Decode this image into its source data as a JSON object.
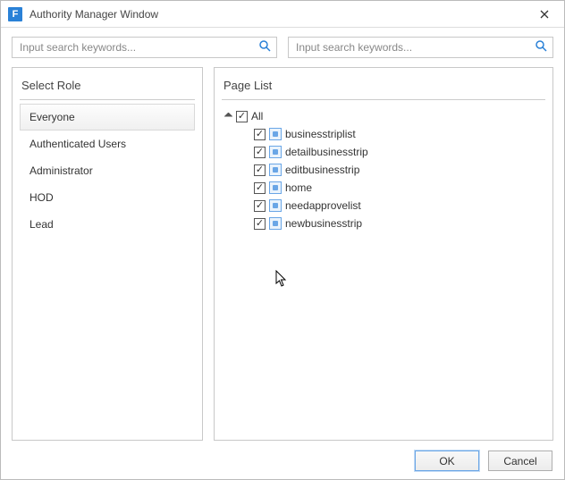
{
  "window": {
    "app_icon_letter": "F",
    "title": "Authority Manager Window"
  },
  "search": {
    "left_placeholder": "Input search keywords...",
    "right_placeholder": "Input search keywords..."
  },
  "roles": {
    "title": "Select Role",
    "items": [
      {
        "label": "Everyone",
        "selected": true
      },
      {
        "label": "Authenticated Users",
        "selected": false
      },
      {
        "label": "Administrator",
        "selected": false
      },
      {
        "label": "HOD",
        "selected": false
      },
      {
        "label": "Lead",
        "selected": false
      }
    ]
  },
  "pages": {
    "title": "Page List",
    "root": {
      "label": "All",
      "checked": true,
      "expanded": true
    },
    "items": [
      {
        "label": "businesstriplist",
        "checked": true
      },
      {
        "label": "detailbusinesstrip",
        "checked": true
      },
      {
        "label": "editbusinesstrip",
        "checked": true
      },
      {
        "label": "home",
        "checked": true
      },
      {
        "label": "needapprovelist",
        "checked": true
      },
      {
        "label": "newbusinesstrip",
        "checked": true
      }
    ]
  },
  "buttons": {
    "ok": "OK",
    "cancel": "Cancel"
  }
}
